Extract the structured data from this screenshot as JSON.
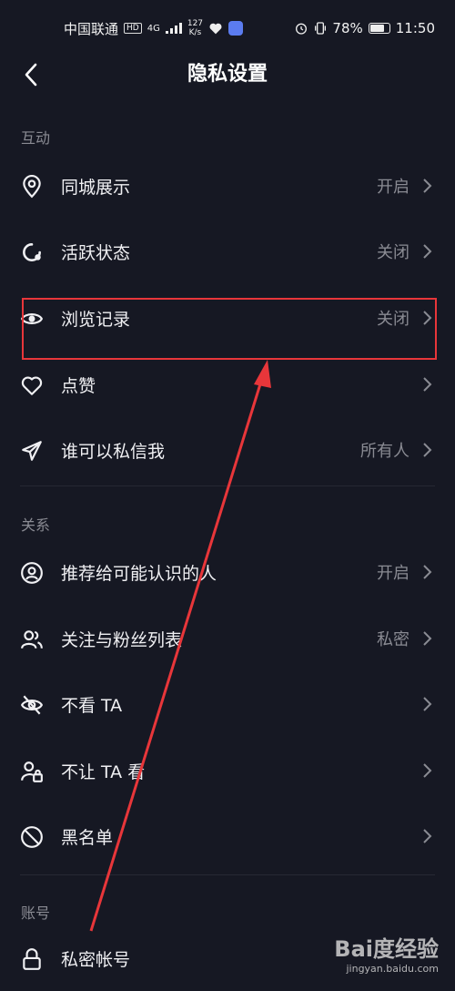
{
  "status_bar": {
    "carrier": "中国联通",
    "hd": "HD",
    "signal": "4G",
    "speed_top": "127",
    "speed_bottom": "K/s",
    "battery_pct": "78%",
    "battery_level": 0.78,
    "time": "11:50"
  },
  "header": {
    "title": "隐私设置"
  },
  "sections": {
    "interaction": "互动",
    "relations": "关系",
    "account": "账号"
  },
  "rows": [
    {
      "label": "同城展示",
      "value": "开启",
      "icon": "location-pin-icon"
    },
    {
      "label": "活跃状态",
      "value": "关闭",
      "icon": "active-status-icon"
    },
    {
      "label": "浏览记录",
      "value": "关闭",
      "icon": "eye-icon"
    },
    {
      "label": "点赞",
      "value": "",
      "icon": "heart-icon"
    },
    {
      "label": "谁可以私信我",
      "value": "所有人",
      "icon": "send-icon"
    },
    {
      "label": "推荐给可能认识的人",
      "value": "开启",
      "icon": "user-circle-icon"
    },
    {
      "label": "关注与粉丝列表",
      "value": "私密",
      "icon": "users-icon"
    },
    {
      "label": "不看 TA",
      "value": "",
      "icon": "eye-off-icon"
    },
    {
      "label": "不让 TA 看",
      "value": "",
      "icon": "user-lock-icon"
    },
    {
      "label": "黑名单",
      "value": "",
      "icon": "block-icon"
    },
    {
      "label": "私密帐号",
      "value": "",
      "icon": "lock-icon"
    }
  ],
  "annotation": {
    "highlight_color": "#e8363a"
  },
  "watermark": {
    "logo": "Bai度经验",
    "url": "jingyan.baidu.com"
  }
}
